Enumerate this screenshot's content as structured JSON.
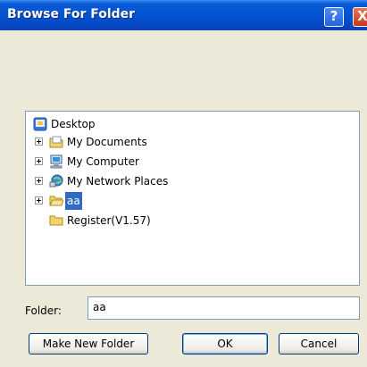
{
  "window": {
    "title": "Browse For Folder",
    "help_glyph": "?",
    "close_glyph": "X"
  },
  "tree": {
    "root": {
      "label": "Desktop",
      "icon": "desktop-icon"
    },
    "items": [
      {
        "label": "My Documents",
        "icon": "documents-folder-icon",
        "expandable": true
      },
      {
        "label": "My Computer",
        "icon": "computer-icon",
        "expandable": true
      },
      {
        "label": "My Network Places",
        "icon": "network-places-icon",
        "expandable": true
      },
      {
        "label": "aa",
        "icon": "folder-open-icon",
        "expandable": true,
        "selected": true
      },
      {
        "label": "Register(V1.57)",
        "icon": "folder-icon",
        "expandable": false
      }
    ]
  },
  "folder_field": {
    "label": "Folder:",
    "value": "aa"
  },
  "buttons": {
    "new_folder": "Make New Folder",
    "ok": "OK",
    "cancel": "Cancel"
  },
  "colors": {
    "titlebar": "#0453d2",
    "dialog_bg": "#ece9d8",
    "selection": "#316ac5"
  }
}
